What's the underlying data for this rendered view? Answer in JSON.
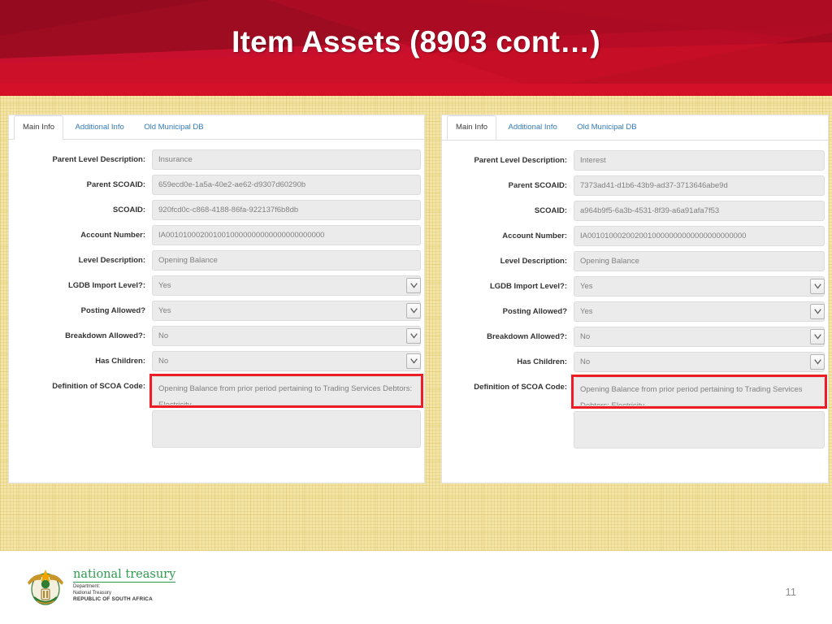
{
  "slide": {
    "title": "Item Assets (8903 cont…)",
    "page_number": "11",
    "accent_red": "#c8102e",
    "highlight_red": "#ee1c25",
    "canvas_yellow": "#f3e5a8"
  },
  "panels": [
    {
      "id": "left",
      "tabs": [
        {
          "label": "Main Info",
          "active": true
        },
        {
          "label": "Additional Info",
          "active": false
        },
        {
          "label": "Old Municipal DB",
          "active": false
        }
      ],
      "fields": [
        {
          "label": "Parent Level Description:",
          "value": "Insurance",
          "type": "text"
        },
        {
          "label": "Parent SCOAID:",
          "value": "659ecd0e-1a5a-40e2-ae62-d9307d60290b",
          "type": "text"
        },
        {
          "label": "SCOAID:",
          "value": "920fcd0c-c868-4188-86fa-922137f6b8db",
          "type": "text"
        },
        {
          "label": "Account Number:",
          "value": "IA0010100020010010000000000000000000000",
          "type": "text"
        },
        {
          "label": "Level Description:",
          "value": "Opening Balance",
          "type": "text"
        },
        {
          "label": "LGDB Import Level?:",
          "value": "Yes",
          "type": "select"
        },
        {
          "label": "Posting Allowed?",
          "value": "Yes",
          "type": "select"
        },
        {
          "label": "Breakdown Allowed?:",
          "value": "No",
          "type": "select"
        },
        {
          "label": "Has Children:",
          "value": "No",
          "type": "select"
        },
        {
          "label": "Definition of SCOA Code:",
          "value": "Opening Balance from prior period pertaining to Trading Services Debtors:  Electricity",
          "type": "textarea",
          "highlighted": true
        },
        {
          "label": "",
          "value": "",
          "type": "textarea-tall",
          "highlighted": false
        }
      ]
    },
    {
      "id": "right",
      "tabs": [
        {
          "label": "Main Info",
          "active": true
        },
        {
          "label": "Additional Info",
          "active": false
        },
        {
          "label": "Old Municipal DB",
          "active": false
        }
      ],
      "fields": [
        {
          "label": "Parent Level Description:",
          "value": "Interest",
          "type": "text"
        },
        {
          "label": "Parent SCOAID:",
          "value": "7373ad41-d1b6-43b9-ad37-3713646abe9d",
          "type": "text"
        },
        {
          "label": "SCOAID:",
          "value": "a964b9f5-6a3b-4531-8f39-a6a91afa7f53",
          "type": "text"
        },
        {
          "label": "Account Number:",
          "value": "IA0010100020020010000000000000000000000",
          "type": "text"
        },
        {
          "label": "Level Description:",
          "value": "Opening Balance",
          "type": "text"
        },
        {
          "label": "LGDB Import Level?:",
          "value": "Yes",
          "type": "select"
        },
        {
          "label": "Posting Allowed?",
          "value": "Yes",
          "type": "select"
        },
        {
          "label": "Breakdown Allowed?:",
          "value": "No",
          "type": "select"
        },
        {
          "label": "Has Children:",
          "value": "No",
          "type": "select"
        },
        {
          "label": "Definition of SCOA Code:",
          "value": "Opening Balance from prior period pertaining to Trading Services Debtors:  Electricity",
          "type": "textarea",
          "highlighted": true
        },
        {
          "label": "",
          "value": "",
          "type": "textarea-tall",
          "highlighted": false
        }
      ]
    }
  ],
  "footer": {
    "logo_title": "national treasury",
    "logo_line1": "Department:",
    "logo_line2": "National Treasury",
    "logo_line3": "REPUBLIC OF SOUTH AFRICA"
  }
}
